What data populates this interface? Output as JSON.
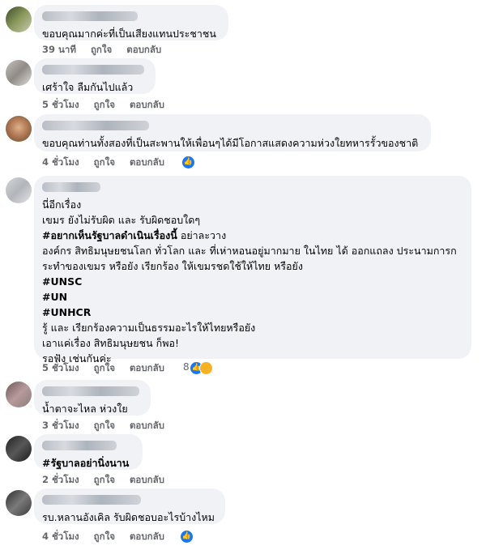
{
  "labels": {
    "like": "ถูกใจ",
    "reply": "ตอบกลับ"
  },
  "icons": {
    "like": "thumbs-up-icon",
    "sad": "sad-face-icon"
  },
  "colors": {
    "like_blue": "#1877f2",
    "bubble": "#f0f2f5",
    "meta": "#65676b"
  },
  "comments": [
    {
      "lines": [
        "ขอบคุณมากค่ะที่เป็นเสียงแทนประชาชน"
      ],
      "time": "39 นาที"
    },
    {
      "lines": [
        "เศร้าใจ ลืมกันไปแล้ว"
      ],
      "time": "5 ชั่วโมง"
    },
    {
      "lines": [
        "ขอบคุณท่านทั้งสองที่เป็นสะพานให้เพื่อนๆได้มีโอกาสแสดงความห่วงใยทหารรั้วของชาติ"
      ],
      "time": "4 ชั่วโมง"
    },
    {
      "lines": [
        "นี่อีกเรื่อง",
        "เขมร ยังไม่รับผิด และ รับผิดชอบใดๆ",
        "อย่าละวาง",
        "องค์กร สิทธิมนุษยชนโลก ทั่วโลก และ ที่เห่าหอนอยู่มากมาย ในไทย ได้ ออกแถลง ประนามการก",
        "ระทำของเขมร หรือยัง เรียกร้อง ให้เขมรชดใช้ให้ไทย หรือยัง",
        "#UNSC",
        "#UN",
        "#UNHCR",
        "รู้ และ เรียกร้องความเป็นธรรมอะไรให้ไทยหรือยัง",
        "เอาแค่เรื่อง สิทธิมนุษยชน ก็พอ!",
        "รอฟัง เช่นกันค่ะ"
      ],
      "hashtag_inline": "#อยากเห็นรัฐบาลดำเนินเรื่องนี้",
      "time": "5 ชั่วโมง",
      "reactions": "8"
    },
    {
      "lines": [
        "น้ำตาจะไหล ห่วงใย"
      ],
      "time": "3 ชั่วโมง"
    },
    {
      "lines": [
        "#รัฐบาลอย่านิ่งนาน"
      ],
      "time": "2 ชั่วโมง"
    },
    {
      "lines": [
        "รบ.หลานอังเคิล รับผิดชอบอะไรบ้างไหม"
      ],
      "time": "4 ชั่วโมง"
    }
  ]
}
